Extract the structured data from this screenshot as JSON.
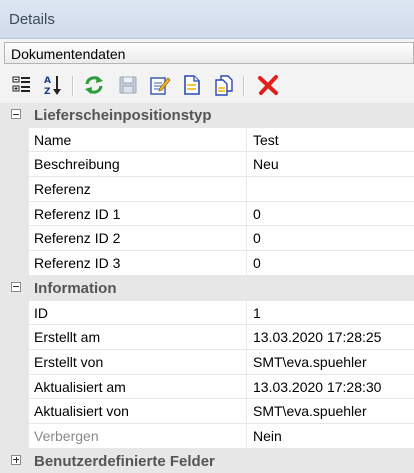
{
  "panel": {
    "title": "Details"
  },
  "selector": {
    "value": "Dokumentendaten"
  },
  "toolbar": {
    "buttons": [
      {
        "icon": "categorized-view-icon"
      },
      {
        "icon": "sort-alphabetical-icon"
      },
      {
        "icon": "refresh-icon"
      },
      {
        "icon": "save-icon"
      },
      {
        "icon": "edit-icon"
      },
      {
        "icon": "new-document-icon"
      },
      {
        "icon": "copy-document-icon"
      },
      {
        "icon": "delete-icon"
      }
    ]
  },
  "grid": {
    "categories": [
      {
        "title": "Lieferscheinpositionstyp",
        "expanded": true,
        "props": [
          {
            "name": "Name",
            "value": "Test"
          },
          {
            "name": "Beschreibung",
            "value": "Neu"
          },
          {
            "name": "Referenz",
            "value": ""
          },
          {
            "name": "Referenz ID 1",
            "value": "0"
          },
          {
            "name": "Referenz ID 2",
            "value": "0"
          },
          {
            "name": "Referenz ID 3",
            "value": "0"
          }
        ]
      },
      {
        "title": "Information",
        "expanded": true,
        "props": [
          {
            "name": "ID",
            "value": "1"
          },
          {
            "name": "Erstellt am",
            "value": "13.03.2020 17:28:25"
          },
          {
            "name": "Erstellt von",
            "value": "SMT\\eva.spuehler"
          },
          {
            "name": "Aktualisiert am",
            "value": "13.03.2020 17:28:30"
          },
          {
            "name": "Aktualisiert von",
            "value": "SMT\\eva.spuehler"
          },
          {
            "name": "Verbergen",
            "value": "Nein",
            "disabled": true
          }
        ]
      },
      {
        "title": "Benutzerdefinierte Felder",
        "expanded": false,
        "props": []
      }
    ]
  },
  "colors": {
    "title_bar": "#d6e0ee",
    "gutter": "#e7e7e7",
    "disabled_text": "#8a8a8a",
    "delete_red": "#e0201b"
  }
}
